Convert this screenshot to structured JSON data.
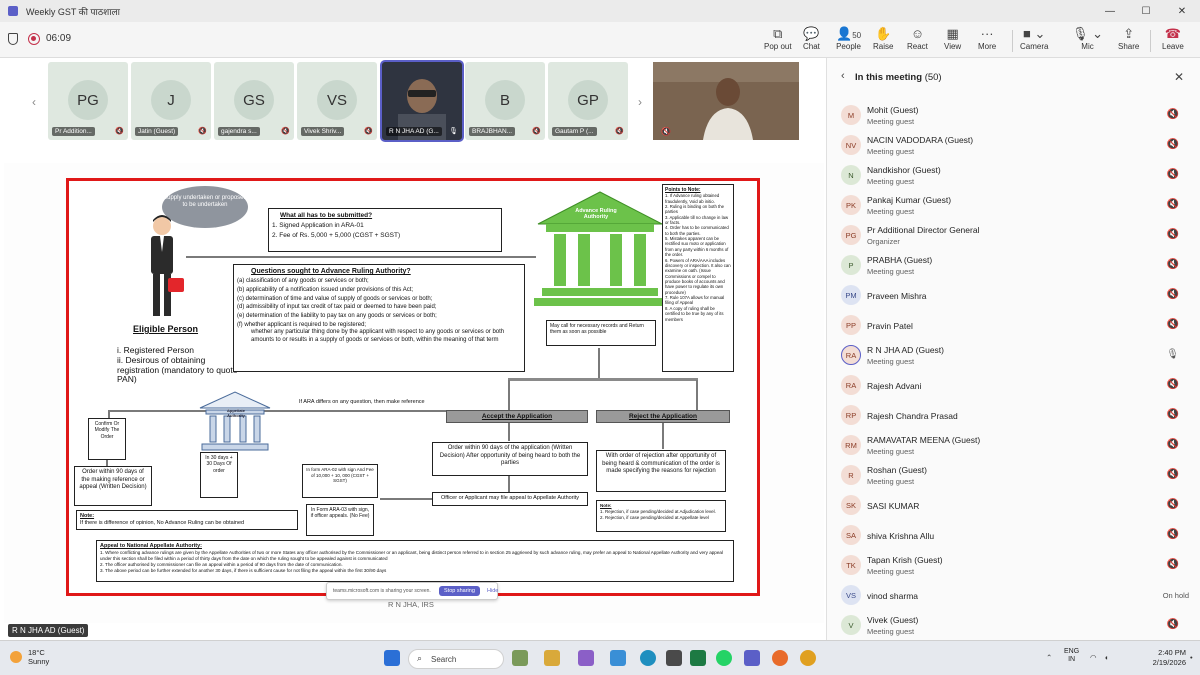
{
  "window": {
    "title": "Weekly GST की पाठशाला",
    "minimize": "—",
    "maximize": "☐",
    "close": "✕"
  },
  "meeting": {
    "timer": "06:09"
  },
  "toolbar": {
    "popout": "Pop out",
    "chat": "Chat",
    "people": "People",
    "people_count": "50",
    "raise": "Raise",
    "react": "React",
    "view": "View",
    "more": "More",
    "camera": "Camera",
    "mic": "Mic",
    "share": "Share",
    "leave": "Leave"
  },
  "gallery": [
    {
      "initials": "PG",
      "name": "Pr Addition..."
    },
    {
      "initials": "J",
      "name": "Jatin (Guest)"
    },
    {
      "initials": "GS",
      "name": "gajendra s..."
    },
    {
      "initials": "VS",
      "name": "Vivek Shriv..."
    },
    {
      "initials": "",
      "name": "R N JHA AD (G..."
    },
    {
      "initials": "B",
      "name": "BRAJBHAN..."
    },
    {
      "initials": "GP",
      "name": "Gautam P (..."
    }
  ],
  "slide": {
    "bubble": "Supply undertaken or proposed to be undertaken",
    "eligible_title": "Eligible Person",
    "eligible_1": "i. Registered Person",
    "eligible_2": "ii. Desirous of obtaining registration (mandatory to quote PAN)",
    "submit_title": "What all has to be submitted?",
    "submit_1": "1.   Signed Application in ARA-01",
    "submit_2": "2.   Fee of Rs. 5,000 + 5,000 (CGST + SGST)",
    "ara_label": "Advance Ruling Authority",
    "questions_title": "Questions sought to Advance Ruling Authority?",
    "q_a": "(a)   classification of any goods or services or  both;",
    "q_b": "(b)   applicability of a notification issued under provisions of this Act;",
    "q_c": "(c)   determination of time and value of supply of goods or services or both;",
    "q_d": "(d)   admissibility of input tax credit of tax paid or deemed to have been paid;",
    "q_e": "(e)   determination of the liability to pay tax on any goods or services or both;",
    "q_f": "(f)    whether applicant is required to be  registered;",
    "q_g": "whether any particular thing done by the applicant with respect to any goods or services or both amounts to or results in a supply of goods or services or both, within the meaning of that  term",
    "may_call": "May call for necessary records and Return them as soon as possible",
    "notes_title": "Points to Note:",
    "notes_1": "1. If Advance ruling obtained fraudulently, Void ab initio.",
    "notes_2": "2. Ruling is binding on both the parties",
    "notes_3": "3. Applicable till no change in law or facts.",
    "notes_4": "4. Order has to be communicated to both the parties.",
    "notes_5": "5. Mistakes apparent can be rectified suo moto or application from any party within 6 months of the order.",
    "notes_6": "6. Powers of ARA/AAA includes discovery or inspection. It also can examine on oath. (Issue Commissions or compel to produce books of accounts and have power to regulate its own procedure)",
    "notes_7": "7. Rule 107A allows for manual filing of Appeal",
    "notes_8": "8. A copy of ruling shall be certified to be true by any of its members",
    "differs": "If ARA differs on any question, then make reference",
    "accept": "Accept the Application",
    "reject": "Reject the Application",
    "appellate": "Appellate Authority",
    "confirm": "Confirm Or Modify The Order",
    "order90": "Order within 90 days of the making reference or appeal (Written Decision)",
    "days30": "In 30 days + 30 Days Of order",
    "ara02": "In form ARA-02 with sign And Fee of 10,000 + 10, 000 (CGST + SGST)",
    "accept_order": "Order within 90 days of the application (Written Decision) After opportunity of being heard to both the parties",
    "reject_order": "With order of rejection after opportunity of being heard & communication of the order is made specifying the reasons for rejection",
    "officer": "Officer or Applicant may file appeal to Appellate Authority",
    "note_title": "Note:",
    "note_text": "If there is difference of opinion, No Advance Ruling can be obtained",
    "ara03": "In Form ARA-03 with sign, if officer appeals. (No Fee)",
    "reject_note_title": "Note:",
    "reject_note_1": "1.   Rejection, if case pending/decided at Adjudication level.",
    "reject_note_2": "2.   Rejection, if case pending/decided at Appellate level",
    "national_title": "Appeal to National Appellate Authority:",
    "national_1": "1.   Where conflicting advance rulings are given by the Appellate Authorities of two or more States any officer authorised by the Commissioner or an applicant, being distinct person referred to in section 25 aggrieved by such advance ruling, may prefer an appeal to National Appellate Authority and very appeal under this section shall be filed within a period of  thirty days from the date on which the ruling sought to be appealed against is communicated",
    "national_2": "2.   The officer authorised by commissioner can file an appeal within a period of 90 days from the date of communication.",
    "national_3": "3.   The above period can be further extended for another 30 days, if there is sufficient cause for not filing the appeal within the first 30/90 days"
  },
  "share_bar": {
    "text": "teams.microsoft.com is sharing your screen.",
    "stop": "Stop sharing",
    "hide": "Hide"
  },
  "presenter_caption": "R N JHA, IRS",
  "name_badge": "R N JHA AD (Guest)",
  "panel": {
    "title": "In this meeting",
    "count": "(50)",
    "participants": [
      {
        "initials": "M",
        "name": "Mohit (Guest)",
        "role": "Meeting guest",
        "status": "mic-off"
      },
      {
        "initials": "NV",
        "name": "NACIN VADODARA (Guest)",
        "role": "Meeting guest",
        "status": "mic-off"
      },
      {
        "initials": "N",
        "name": "Nandkishor (Guest)",
        "role": "Meeting guest",
        "status": "mic-off"
      },
      {
        "initials": "PK",
        "name": "Pankaj Kumar (Guest)",
        "role": "Meeting guest",
        "status": "mic-off"
      },
      {
        "initials": "PG",
        "name": "Pr Additional Director General",
        "role": "Organizer",
        "status": "mic-off"
      },
      {
        "initials": "P",
        "name": "PRABHA (Guest)",
        "role": "Meeting guest",
        "status": "mic-off"
      },
      {
        "initials": "PM",
        "name": "Praveen Mishra",
        "role": "",
        "status": "mic-off"
      },
      {
        "initials": "PP",
        "name": "Pravin Patel",
        "role": "",
        "status": "mic-off"
      },
      {
        "initials": "RA",
        "name": "R N JHA AD (Guest)",
        "role": "Meeting guest",
        "status": "mic-on"
      },
      {
        "initials": "RA",
        "name": "Rajesh Advani",
        "role": "",
        "status": "mic-off"
      },
      {
        "initials": "RP",
        "name": "Rajesh Chandra Prasad",
        "role": "",
        "status": "mic-off"
      },
      {
        "initials": "RM",
        "name": "RAMAVATAR MEENA (Guest)",
        "role": "Meeting guest",
        "status": "mic-off"
      },
      {
        "initials": "R",
        "name": "Roshan (Guest)",
        "role": "Meeting guest",
        "status": "mic-off"
      },
      {
        "initials": "SK",
        "name": "SASI KUMAR",
        "role": "",
        "status": "mic-off"
      },
      {
        "initials": "SA",
        "name": "shiva Krishna Allu",
        "role": "",
        "status": "mic-off"
      },
      {
        "initials": "TK",
        "name": "Tapan Krish (Guest)",
        "role": "Meeting guest",
        "status": "mic-off"
      },
      {
        "initials": "VS",
        "name": "vinod sharma",
        "role": "",
        "status": "On hold"
      },
      {
        "initials": "V",
        "name": "Vivek (Guest)",
        "role": "Meeting guest",
        "status": "mic-off"
      }
    ]
  },
  "taskbar": {
    "temp": "18°C",
    "weather": "Sunny",
    "search": "Search",
    "lang_1": "ENG",
    "lang_2": "IN",
    "time": "2:40 PM",
    "date": "2/19/2026"
  }
}
